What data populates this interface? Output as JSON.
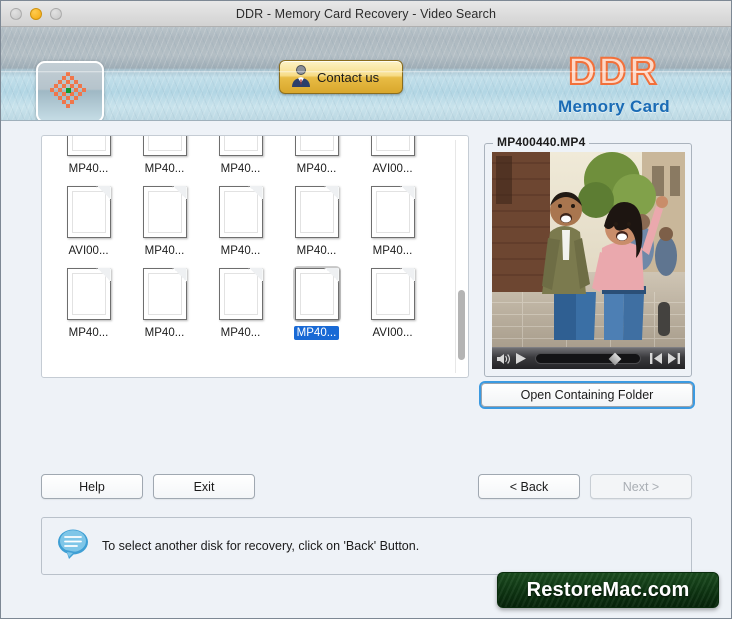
{
  "window": {
    "title": "DDR - Memory Card Recovery - Video Search",
    "traffic_lights": [
      "close",
      "minimize",
      "maximize"
    ]
  },
  "header": {
    "app_icon_name": "checkered-flower-icon",
    "contact_button": {
      "label": "Contact us",
      "icon": "person-icon"
    },
    "brand": {
      "title": "DDR",
      "subtitle": "Memory Card",
      "title_color": "#f2703a",
      "subtitle_color": "#1a6bb5"
    }
  },
  "files": {
    "rows": [
      [
        {
          "label": "MP40...",
          "selected": false
        },
        {
          "label": "MP40...",
          "selected": false
        },
        {
          "label": "MP40...",
          "selected": false
        },
        {
          "label": "MP40...",
          "selected": false
        },
        {
          "label": "AVI00...",
          "selected": false
        }
      ],
      [
        {
          "label": "AVI00...",
          "selected": false
        },
        {
          "label": "MP40...",
          "selected": false
        },
        {
          "label": "MP40...",
          "selected": false
        },
        {
          "label": "MP40...",
          "selected": false
        },
        {
          "label": "MP40...",
          "selected": false
        }
      ],
      [
        {
          "label": "MP40...",
          "selected": false
        },
        {
          "label": "MP40...",
          "selected": false
        },
        {
          "label": "MP40...",
          "selected": false
        },
        {
          "label": "MP40...",
          "selected": true
        },
        {
          "label": "AVI00...",
          "selected": false
        }
      ]
    ],
    "selection_color": "#1869d5"
  },
  "preview": {
    "filename": "MP400440.MP4",
    "controls": {
      "volume": "volume-icon",
      "play": "play-icon",
      "step_back": "step-backward-icon",
      "step_forward": "step-forward-icon",
      "progress_percent": 76
    },
    "open_folder_label": "Open Containing Folder"
  },
  "footer": {
    "help_label": "Help",
    "exit_label": "Exit",
    "back_label": "< Back",
    "next_label": "Next >",
    "next_disabled": true
  },
  "status": {
    "icon": "speech-bubble-icon",
    "message": "To select another disk for recovery, click on 'Back' Button."
  },
  "watermark": {
    "text": "RestoreMac.com",
    "background_color": "#0e3512"
  }
}
